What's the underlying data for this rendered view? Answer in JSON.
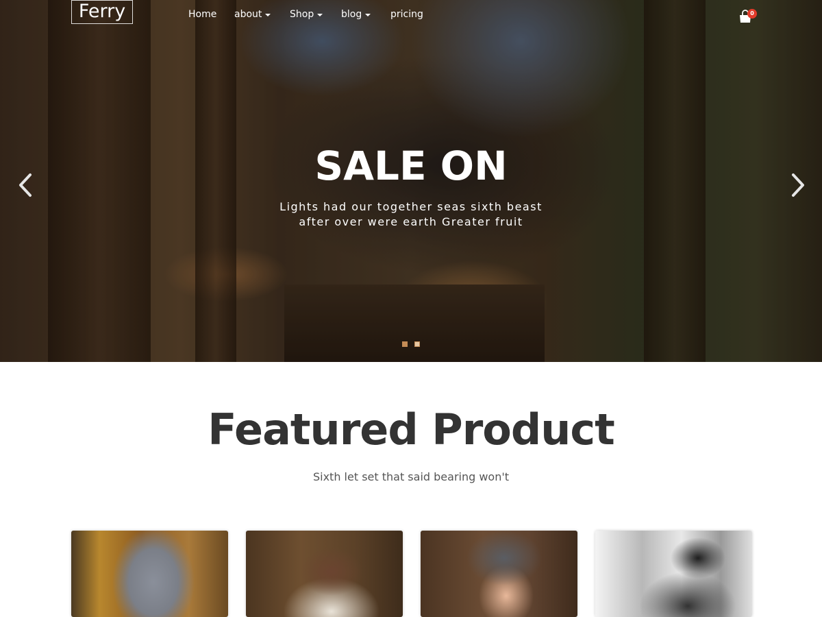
{
  "brand": {
    "logo": "Ferry"
  },
  "nav": {
    "items": [
      {
        "label": "Home",
        "has_dropdown": false
      },
      {
        "label": "about",
        "has_dropdown": true
      },
      {
        "label": "Shop",
        "has_dropdown": true
      },
      {
        "label": "blog",
        "has_dropdown": true
      },
      {
        "label": "pricing",
        "has_dropdown": false
      }
    ],
    "cart_count": "0",
    "cart_icon": "shopping-bag-icon"
  },
  "hero": {
    "title": "SALE ON",
    "subtitle_line1": "Lights had our together seas sixth beast",
    "subtitle_line2": "after over were earth Greater fruit",
    "prev_icon": "chevron-left-icon",
    "next_icon": "chevron-right-icon",
    "slide_count": 2,
    "active_slide": 2
  },
  "featured": {
    "title": "Featured Product",
    "subtitle": "Sixth let set that said bearing won't"
  },
  "colors": {
    "accent": "#c58c56",
    "badge": "#e23a2a",
    "heading": "#333333",
    "text": "#555555"
  }
}
